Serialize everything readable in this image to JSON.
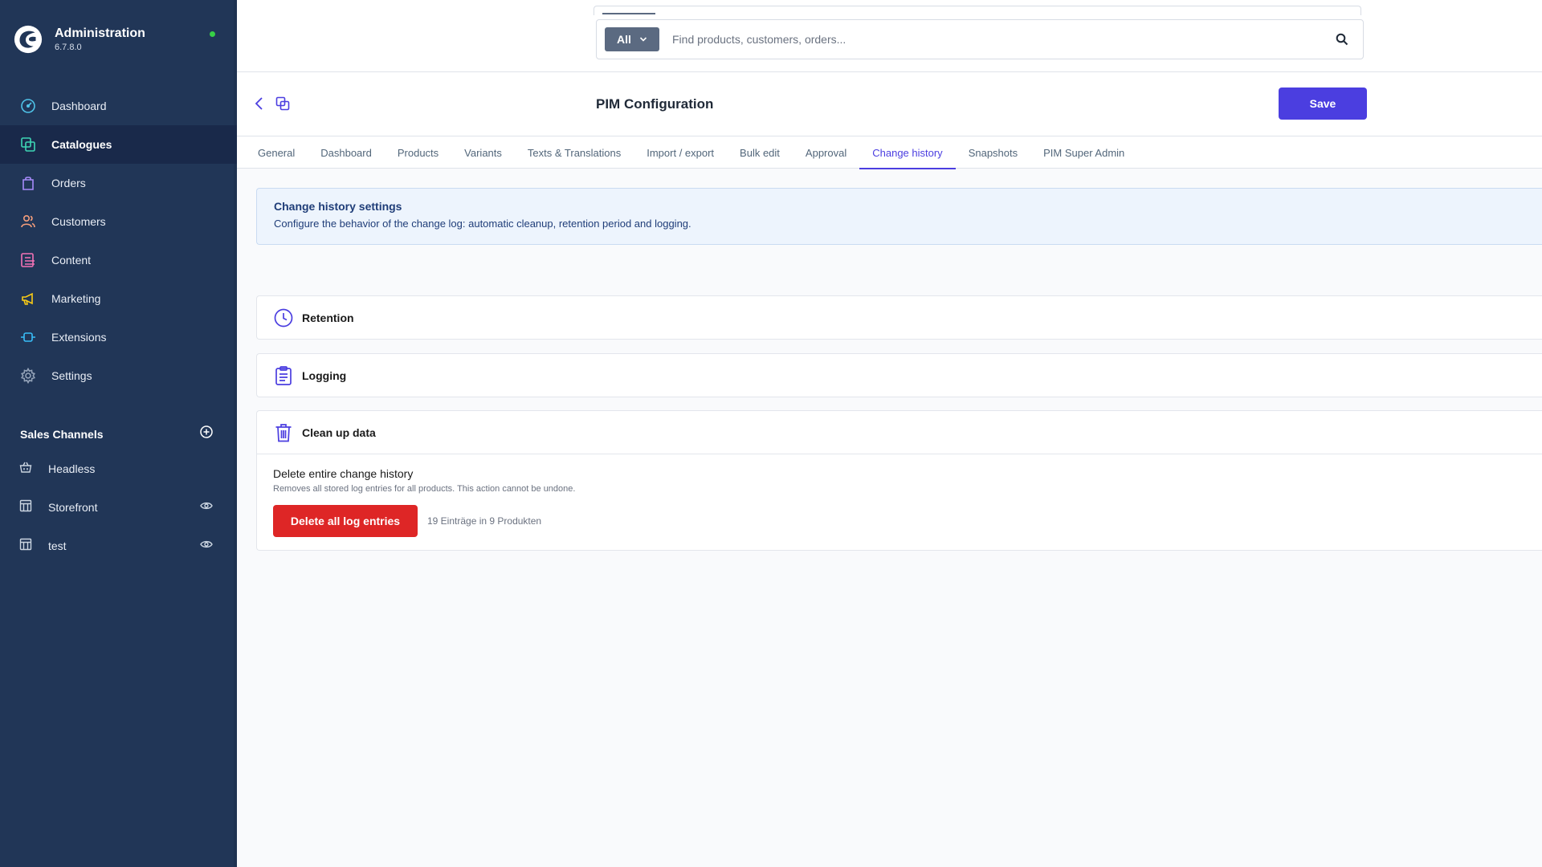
{
  "sidebar": {
    "brand": {
      "title": "Administration",
      "version": "6.7.8.0"
    },
    "nav": [
      {
        "label": "Dashboard",
        "icon": "dashboard-icon"
      },
      {
        "label": "Catalogues",
        "icon": "catalogues-icon"
      },
      {
        "label": "Orders",
        "icon": "orders-icon"
      },
      {
        "label": "Customers",
        "icon": "customers-icon"
      },
      {
        "label": "Content",
        "icon": "content-icon"
      },
      {
        "label": "Marketing",
        "icon": "marketing-icon"
      },
      {
        "label": "Extensions",
        "icon": "extensions-icon"
      },
      {
        "label": "Settings",
        "icon": "settings-icon"
      }
    ],
    "active_nav": "Catalogues",
    "sales_channels": {
      "title": "Sales Channels",
      "items": [
        {
          "label": "Headless",
          "icon": "basket-icon"
        },
        {
          "label": "Storefront",
          "icon": "storefront-icon"
        },
        {
          "label": "test",
          "icon": "storefront-icon"
        }
      ]
    }
  },
  "search": {
    "type_label": "All",
    "placeholder": "Find products, customers, orders..."
  },
  "page": {
    "title": "PIM Configuration",
    "save_label": "Save"
  },
  "tabs": [
    "General",
    "Dashboard",
    "Products",
    "Variants",
    "Texts & Translations",
    "Import / export",
    "Bulk edit",
    "Approval",
    "Change history",
    "Snapshots",
    "PIM Super Admin"
  ],
  "active_tab": "Change history",
  "info": {
    "title": "Change history settings",
    "text": "Configure the behavior of the change log: automatic cleanup, retention period and logging."
  },
  "sections": {
    "retention": {
      "title": "Retention"
    },
    "logging": {
      "title": "Logging"
    },
    "cleanup": {
      "title": "Clean up data",
      "delete_title": "Delete entire change history",
      "delete_desc": "Removes all stored log entries for all products. This action cannot be undone.",
      "delete_button": "Delete all log entries",
      "count_text": "19 Einträge in 9 Produkten"
    }
  },
  "colors": {
    "sidebar_bg": "#213657",
    "accent": "#4b3ee0",
    "danger": "#de2626",
    "status_online": "#37d046"
  }
}
